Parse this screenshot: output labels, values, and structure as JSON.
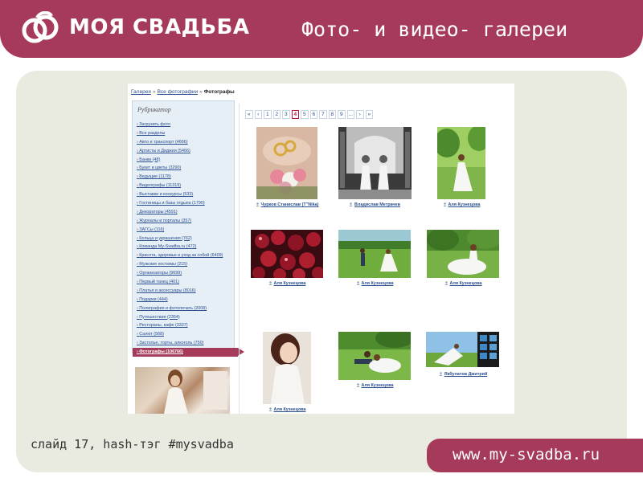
{
  "header": {
    "brand": "МОЯ СВАДЬБА",
    "title": "Фото-  и видео- галереи",
    "color": "#a63a5a"
  },
  "breadcrumb": {
    "items": [
      "Галерея",
      "Все фотографии",
      "Фотографы"
    ],
    "separator": "»"
  },
  "sidebar": {
    "title": "Рубрикатор",
    "items": [
      "Загрузить фото",
      "Все разделы",
      "Авто и транспорт (4666)",
      "Артисты и Диджеи (5466)",
      "Банки (48)",
      "Букет и цветы (3290)",
      "Ведущие (1178)",
      "Видеографы (11319)",
      "Выставки и конкурсы (533)",
      "Гостиницы и базы отдыха (1790)",
      "Декораторы (4591)",
      "Журналы и порталы (357)",
      "ЗАГСы (116)",
      "Кольца и украшения (762)",
      "Команда My-Svadba.ru (472)",
      "Красота, здоровье и уход за собой (6409)",
      "Мужские костюмы (215)",
      "Организаторы (9699)",
      "Первый танец (401)",
      "Платья и аксессуары (8016)",
      "Подарки (444)",
      "Полиграфия и фотопечать (2008)",
      "Путешествия (2354)",
      "Рестораны, кафе (3337)",
      "Салют (568)",
      "Застолье, торты, алкоголь (750)",
      "Фотографы (106766)"
    ],
    "active_index": 26
  },
  "pager": {
    "items": [
      "«",
      "‹",
      "1",
      "2",
      "3",
      "4",
      "5",
      "6",
      "7",
      "8",
      "9",
      "...",
      "›",
      "»"
    ],
    "current": "4"
  },
  "gallery": [
    {
      "author": "Чурков Станислав (Т\"Nika)"
    },
    {
      "author": "Владислав Метрачев"
    },
    {
      "author": "Аля Кузнецова"
    },
    {
      "author": "Аля Кузнецова"
    },
    {
      "author": "Аля Кузнецова"
    },
    {
      "author": "Аля Кузнецова"
    },
    {
      "author": "Аля Кузнецова"
    },
    {
      "author": "Аля Кузнецова"
    },
    {
      "author": "Якбулатов Дмитрий"
    }
  ],
  "footer": {
    "note": "слайд 17, hash-тэг #mysvadba",
    "url": "www.my-svadba.ru"
  }
}
